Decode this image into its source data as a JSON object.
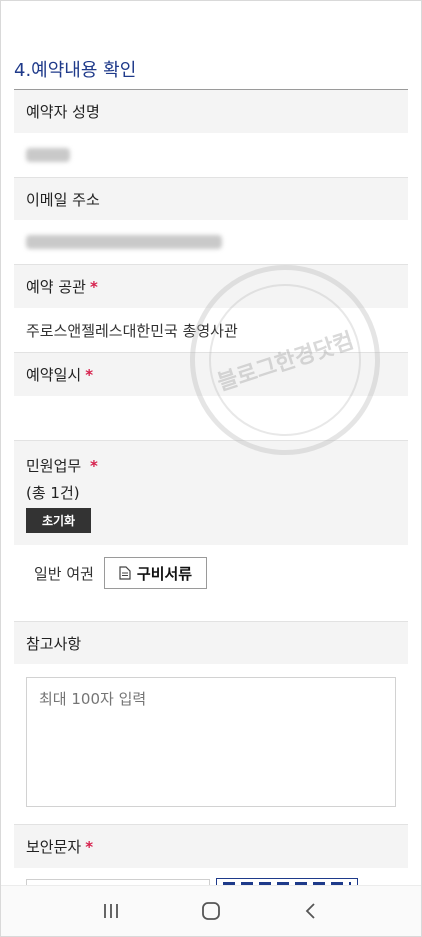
{
  "section": {
    "title": "4.예약내용 확인"
  },
  "fields": {
    "name_label": "예약자 성명",
    "email_label": "이메일 주소",
    "office_label": "예약 공관",
    "office_value": "주로스앤젤레스대한민국 총영사관",
    "datetime_label": "예약일시",
    "service_label": "민원업무",
    "service_count": "(총 1건)",
    "reset_label": "초기화",
    "service_item": "일반 여권",
    "docs_label": "구비서류",
    "notes_label": "참고사항",
    "notes_placeholder": "최대 100자 입력",
    "captcha_label": "보안문자",
    "required_mark": "*"
  },
  "watermark": {
    "text": "블로그한경닷컴"
  },
  "nav": {
    "icons": [
      "recent-apps-icon",
      "home-icon",
      "back-icon"
    ]
  }
}
